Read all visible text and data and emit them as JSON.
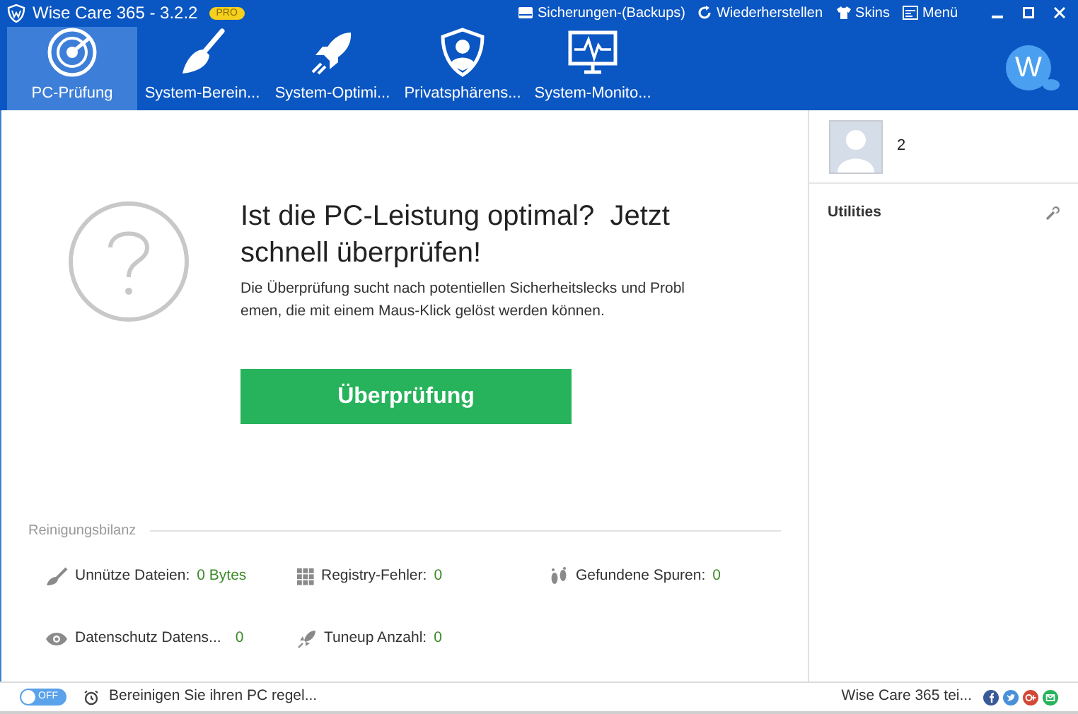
{
  "window": {
    "title": "Wise Care 365 - 3.2.2",
    "badge": "PRO"
  },
  "top_menu": [
    {
      "kind": "backup",
      "label": "Sicherungen-(Backups)"
    },
    {
      "kind": "restore",
      "label": "Wiederherstellen"
    },
    {
      "kind": "skins",
      "label": "Skins"
    },
    {
      "kind": "menu",
      "label": "Menü"
    }
  ],
  "tabs": [
    {
      "kind": "check",
      "label": "PC-Prüfung",
      "selected": true
    },
    {
      "kind": "clean",
      "label": "System-Berein...",
      "selected": false
    },
    {
      "kind": "optimize",
      "label": "System-Optimi...",
      "selected": false
    },
    {
      "kind": "privacy",
      "label": "Privatsphärens...",
      "selected": false
    },
    {
      "kind": "monitor",
      "label": "System-Monito...",
      "selected": false
    }
  ],
  "avatar": {
    "letter": "W"
  },
  "main": {
    "heading": "Ist die PC-Leistung optimal?  Jetzt schnell überprüfen!",
    "description": "Die Überprüfung sucht nach potentiellen Sicherheitslecks und Probl emen, die mit einem Maus-Klick gelöst werden können.",
    "button": "Überprüfung"
  },
  "summary": {
    "title": "Reinigungsbilanz",
    "stats": [
      {
        "kind": "junk",
        "label": "Unnütze Dateien:",
        "value": "0 Bytes"
      },
      {
        "kind": "registry",
        "label": "Registry-Fehler:",
        "value": "0"
      },
      {
        "kind": "traces",
        "label": "Gefundene Spuren:",
        "value": "0"
      },
      {
        "kind": "privacy",
        "label": "Datenschutz Datens...",
        "value": "0"
      },
      {
        "kind": "tuneup",
        "label": "Tuneup Anzahl:",
        "value": "0"
      }
    ]
  },
  "sidebar": {
    "user_count": "2",
    "section": "Utilities"
  },
  "status_bar": {
    "toggle": {
      "label": "OFF",
      "on": false
    },
    "schedule_text": "Bereinigen Sie ihren PC regel...",
    "share_text": "Wise Care 365 tei..."
  }
}
